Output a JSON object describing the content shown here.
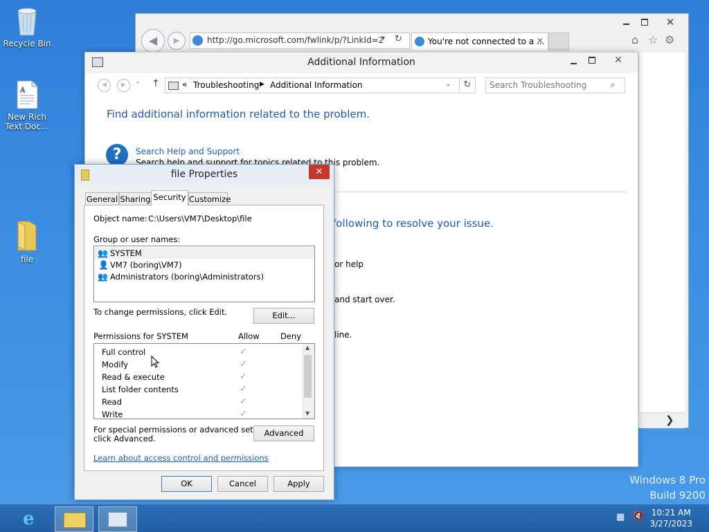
{
  "desktop": {
    "icons": [
      {
        "label_line1": "Recycle Bin",
        "label_line2": ""
      },
      {
        "label_line1": "New Rich",
        "label_line2": "Text Doc..."
      },
      {
        "label_line1": "file",
        "label_line2": ""
      }
    ],
    "watermark": {
      "line1": "Windows 8 Pro",
      "line2": "Build 9200"
    }
  },
  "ie": {
    "address": "http://go.microsoft.com/fwlink/p/?LinkId=2",
    "tab_title": "You're not connected to a ..."
  },
  "additional_info": {
    "title": "Additional Information",
    "breadcrumb": {
      "prefix": "«",
      "item1": "Troubleshooting",
      "item2": "Additional Information"
    },
    "search_placeholder": "Search Troubleshooting",
    "heading": "Find additional information related to the problem.",
    "help_link": "Search Help and Support",
    "help_desc": "Search help and support for topics related to this problem.",
    "partial_heading": "following to resolve your issue.",
    "partial1": "or help",
    "partial2": "and start over.",
    "partial3": "line."
  },
  "properties": {
    "title": "file Properties",
    "tabs": [
      "General",
      "Sharing",
      "Security",
      "Customize"
    ],
    "object_name_label": "Object name:",
    "object_name_value": "C:\\Users\\VM7\\Desktop\\file",
    "group_label": "Group or user names:",
    "groups": [
      "SYSTEM",
      "VM7 (boring\\VM7)",
      "Administrators (boring\\Administrators)"
    ],
    "change_text": "To change permissions, click Edit.",
    "edit_button": "Edit...",
    "perm_label": "Permissions for SYSTEM",
    "allow_header": "Allow",
    "deny_header": "Deny",
    "permissions": [
      "Full control",
      "Modify",
      "Read & execute",
      "List folder contents",
      "Read",
      "Write"
    ],
    "special_text_line1": "For special permissions or advanced settings,",
    "special_text_line2": "click Advanced.",
    "advanced_button": "Advanced",
    "learn_link": "Learn about access control and permissions",
    "ok_button": "OK",
    "cancel_button": "Cancel",
    "apply_button": "Apply",
    "check_glyph": "✓"
  },
  "taskbar": {
    "time": "10:21 AM",
    "date": "3/27/2023"
  },
  "colors": {
    "desktop": "#3b8ee3",
    "close_red": "#c7362a",
    "link_blue": "#1a5fb4"
  }
}
